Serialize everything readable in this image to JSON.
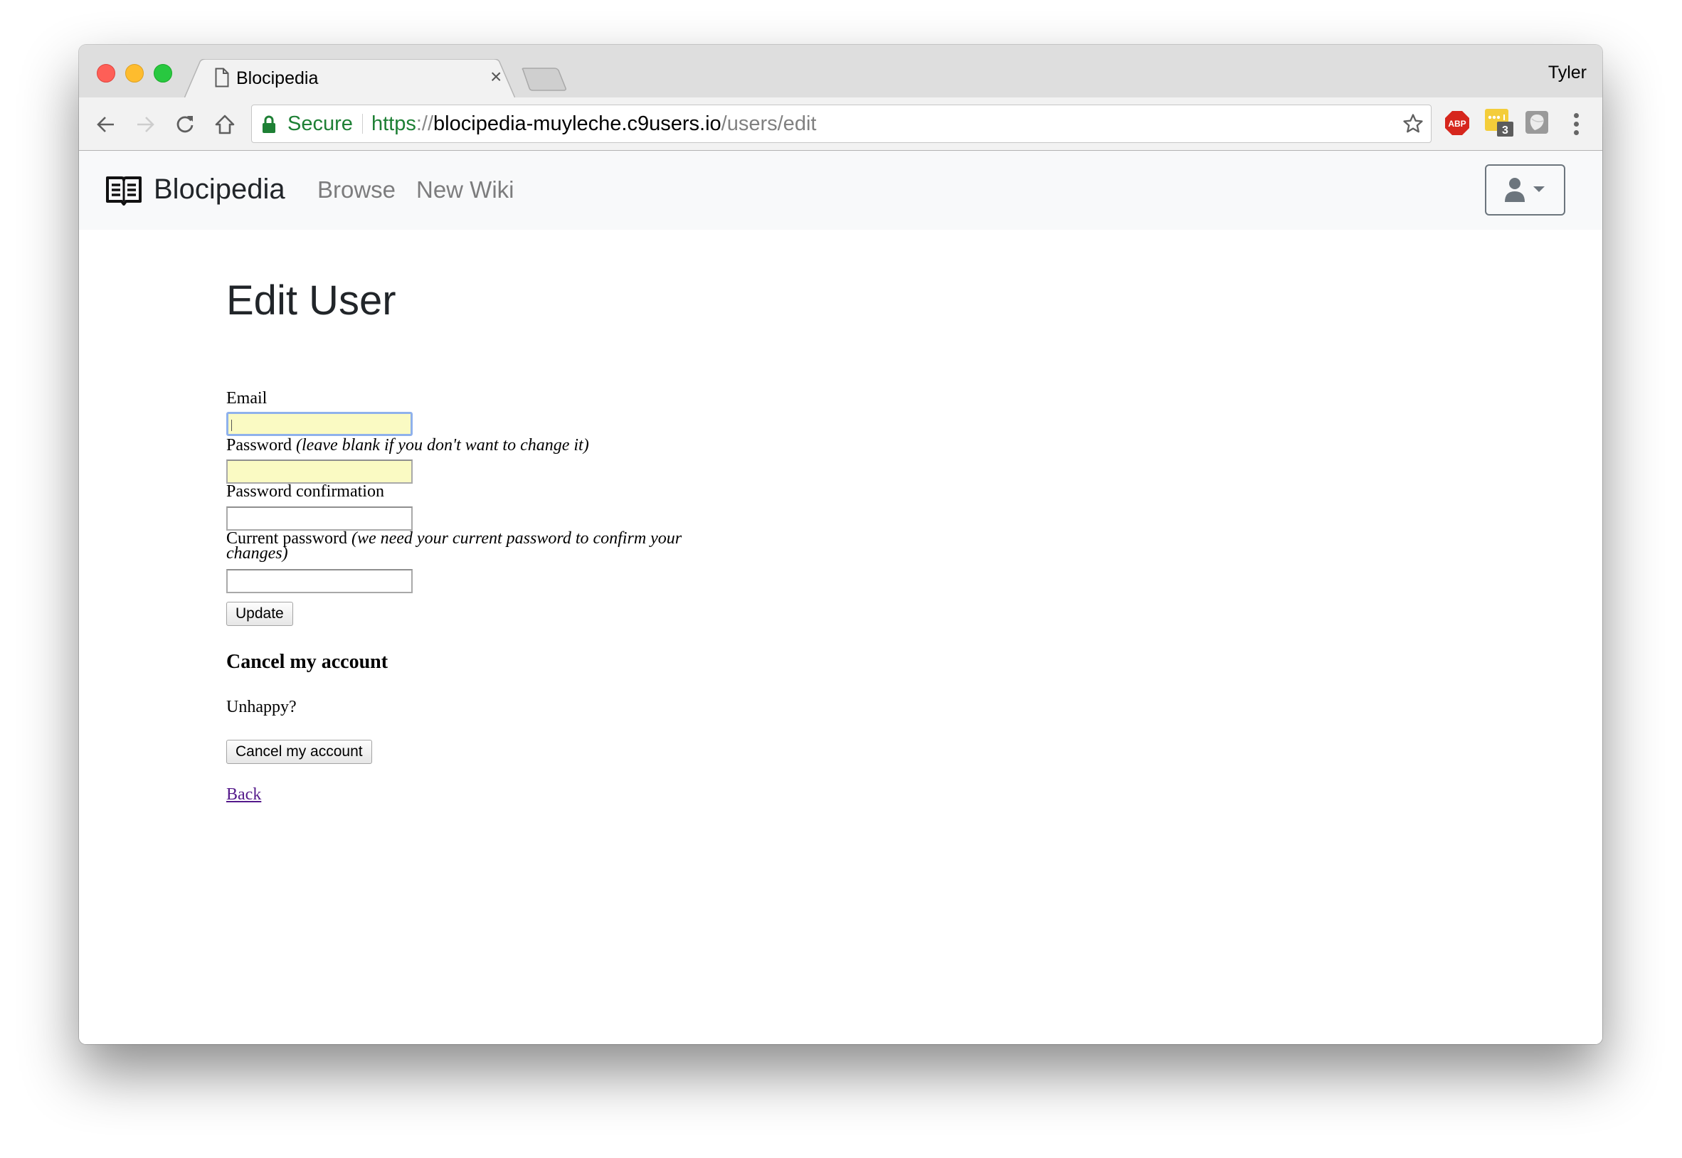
{
  "browser": {
    "profile_name": "Tyler",
    "tab": {
      "title": "Blocipedia",
      "close_glyph": "×"
    },
    "omnibox": {
      "secure_label": "Secure",
      "url_scheme": "https",
      "url_separator": "://",
      "url_host": "blocipedia-muyleche.c9users.io",
      "url_path": "/users/edit"
    },
    "extensions": [
      {
        "name": "adblock-plus",
        "label": "ABP"
      },
      {
        "name": "lastpass",
        "badge": "3"
      },
      {
        "name": "ghostery"
      }
    ]
  },
  "navbar": {
    "brand": "Blocipedia",
    "links": [
      "Browse",
      "New Wiki"
    ]
  },
  "page": {
    "title": "Edit User",
    "form": {
      "email_label": "Email",
      "email_value": "",
      "password_label": "Password",
      "password_hint": "(leave blank if you don't want to change it)",
      "password_value": "",
      "password_confirmation_label": "Password confirmation",
      "password_confirmation_value": "",
      "current_password_label": "Current password",
      "current_password_hint_line1": "(we need your current password to confirm your",
      "current_password_hint_line2": "changes)",
      "current_password_value": "",
      "submit_label": "Update"
    },
    "cancel_section": {
      "heading": "Cancel my account",
      "text": "Unhappy?",
      "button_label": "Cancel my account"
    },
    "back_link": "Back"
  },
  "colors": {
    "secure_green": "#1e8035",
    "navbar_bg": "#f8f9fa",
    "autofill_yellow": "#fafac3",
    "visited_link": "#551a8b"
  }
}
